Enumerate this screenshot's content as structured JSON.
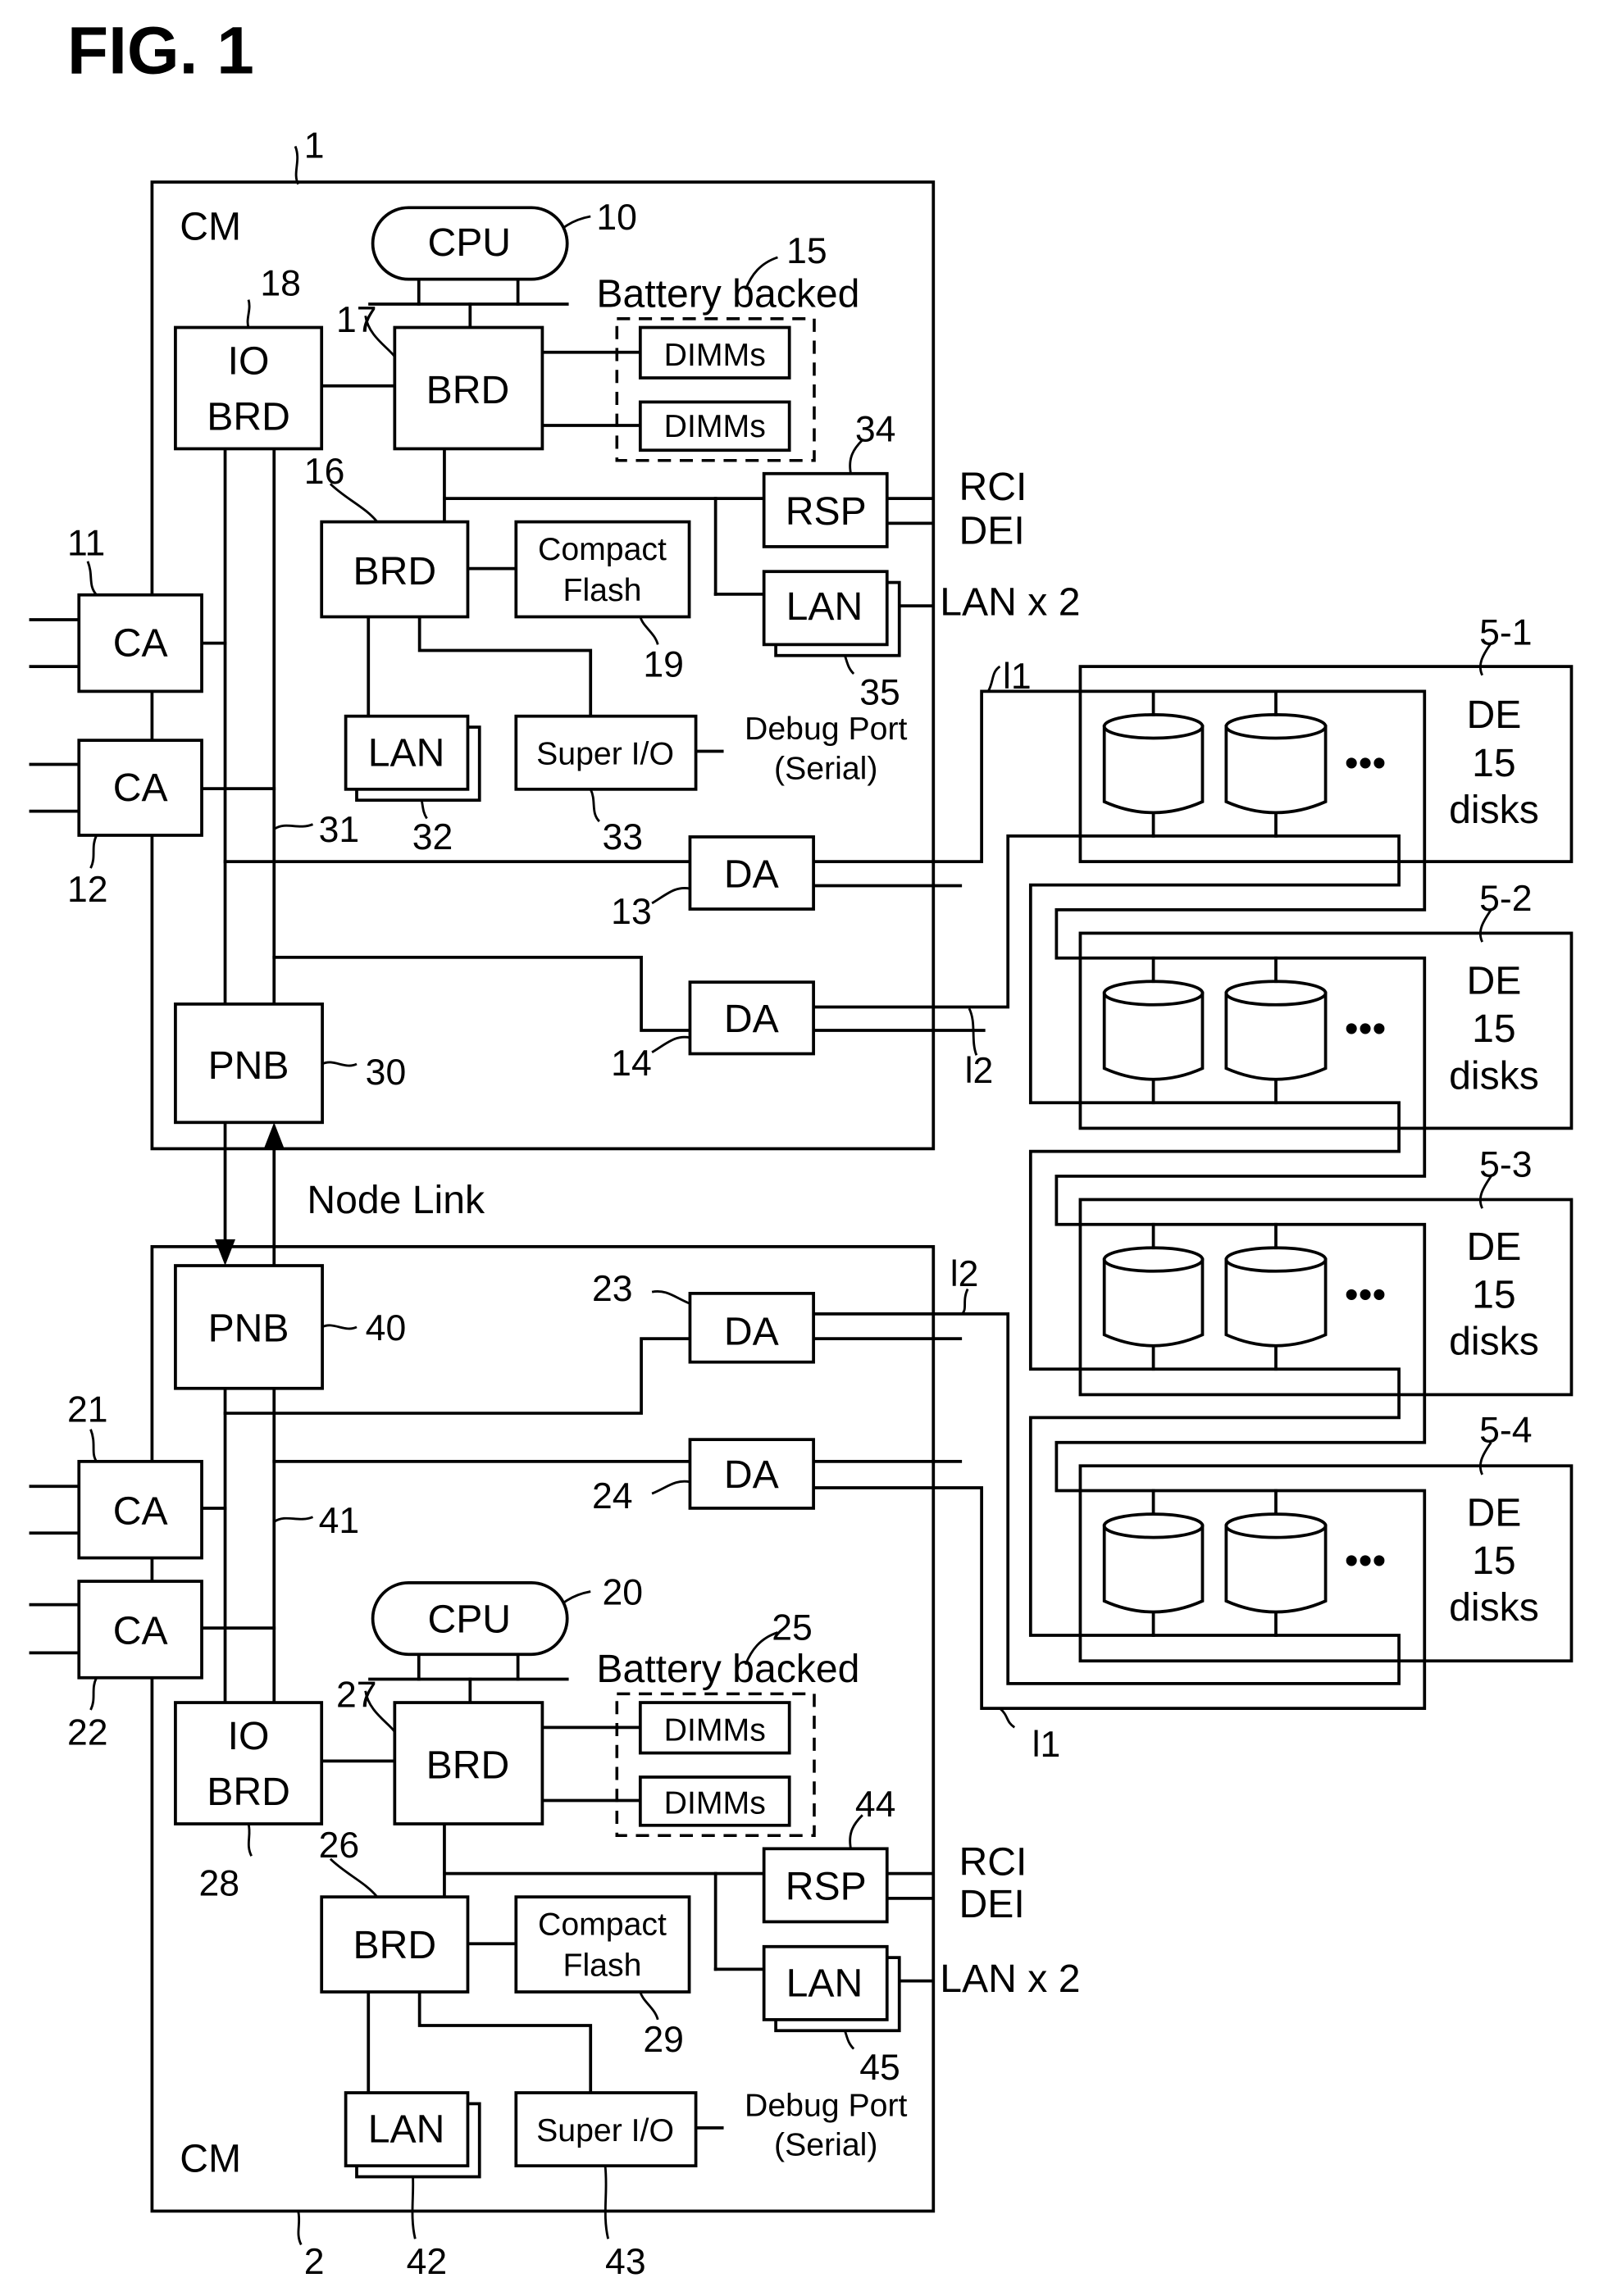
{
  "figure": {
    "title": "FIG. 1",
    "node_link_label": "Node Link"
  },
  "cm1": {
    "ref": "1",
    "label": "CM",
    "cpu": {
      "label": "CPU",
      "ref": "10"
    },
    "system_brd": {
      "label": "BRD",
      "ref": "17"
    },
    "io_brd": {
      "line1": "IO",
      "line2": "BRD",
      "ref": "18"
    },
    "battery": {
      "label": "Battery backed",
      "ref": "15",
      "dimms": [
        "DIMMs",
        "DIMMs"
      ]
    },
    "sub_brd": {
      "label": "BRD",
      "ref": "16"
    },
    "compact_flash": {
      "line1": "Compact",
      "line2": "Flash",
      "ref": "19"
    },
    "rsp": {
      "label": "RSP",
      "ref": "34",
      "out1": "RCI",
      "out2": "DEI"
    },
    "lan_ext": {
      "label": "LAN",
      "ref": "35",
      "out": "LAN x 2"
    },
    "lan_int": {
      "label": "LAN",
      "ref": "32"
    },
    "super_io": {
      "label": "Super I/O",
      "ref": "33",
      "port_line1": "Debug Port",
      "port_line2": "(Serial)"
    },
    "ca": [
      {
        "label": "CA",
        "ref": "11"
      },
      {
        "label": "CA",
        "ref": "12"
      }
    ],
    "da": [
      {
        "label": "DA",
        "ref": "13"
      },
      {
        "label": "DA",
        "ref": "14"
      }
    ],
    "bus_ref": "31",
    "pnb": {
      "label": "PNB",
      "ref": "30"
    }
  },
  "cm2": {
    "ref": "2",
    "label": "CM",
    "cpu": {
      "label": "CPU",
      "ref": "20"
    },
    "system_brd": {
      "label": "BRD",
      "ref": "27"
    },
    "io_brd": {
      "line1": "IO",
      "line2": "BRD",
      "ref": "28"
    },
    "battery": {
      "label": "Battery backed",
      "ref": "25",
      "dimms": [
        "DIMMs",
        "DIMMs"
      ]
    },
    "sub_brd": {
      "label": "BRD",
      "ref": "26"
    },
    "compact_flash": {
      "line1": "Compact",
      "line2": "Flash",
      "ref": "29"
    },
    "rsp": {
      "label": "RSP",
      "ref": "44",
      "out1": "RCI",
      "out2": "DEI"
    },
    "lan_ext": {
      "label": "LAN",
      "ref": "45",
      "out": "LAN x 2"
    },
    "lan_int": {
      "label": "LAN",
      "ref": "42"
    },
    "super_io": {
      "label": "Super I/O",
      "ref": "43",
      "port_line1": "Debug Port",
      "port_line2": "(Serial)"
    },
    "ca": [
      {
        "label": "CA",
        "ref": "21"
      },
      {
        "label": "CA",
        "ref": "22"
      }
    ],
    "da": [
      {
        "label": "DA",
        "ref": "23"
      },
      {
        "label": "DA",
        "ref": "24"
      }
    ],
    "bus_ref": "41",
    "pnb": {
      "label": "PNB",
      "ref": "40"
    }
  },
  "links": {
    "l1": "l1",
    "l2": "l2"
  },
  "drive_enclosures": [
    {
      "ref": "5-1",
      "line1": "DE",
      "line2": "15",
      "line3": "disks",
      "ellipsis": "•••"
    },
    {
      "ref": "5-2",
      "line1": "DE",
      "line2": "15",
      "line3": "disks",
      "ellipsis": "•••"
    },
    {
      "ref": "5-3",
      "line1": "DE",
      "line2": "15",
      "line3": "disks",
      "ellipsis": "•••"
    },
    {
      "ref": "5-4",
      "line1": "DE",
      "line2": "15",
      "line3": "disks",
      "ellipsis": "•••"
    }
  ]
}
